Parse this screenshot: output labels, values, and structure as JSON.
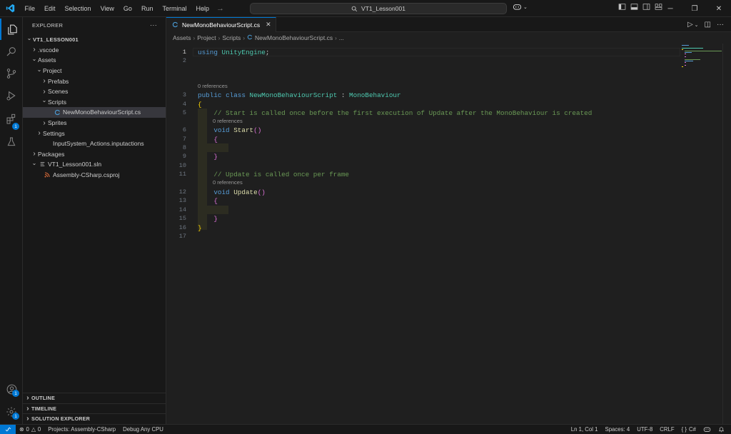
{
  "titlebar": {
    "menu": [
      "File",
      "Edit",
      "Selection",
      "View",
      "Go",
      "Run",
      "Terminal",
      "Help"
    ],
    "search_text": "VT1_Lesson001"
  },
  "activity_bar": {
    "extensions_badge": "1",
    "accounts_badge": "1",
    "settings_badge": "1"
  },
  "sidebar": {
    "title": "EXPLORER",
    "more": "···",
    "tree": [
      {
        "label": "VT1_LESSON001",
        "depth": 0,
        "chevron": "down",
        "icon": "",
        "root": true
      },
      {
        "label": ".vscode",
        "depth": 1,
        "chevron": "right",
        "icon": ""
      },
      {
        "label": "Assets",
        "depth": 1,
        "chevron": "down",
        "icon": ""
      },
      {
        "label": "Project",
        "depth": 2,
        "chevron": "down",
        "icon": ""
      },
      {
        "label": "Prefabs",
        "depth": 3,
        "chevron": "right",
        "icon": ""
      },
      {
        "label": "Scenes",
        "depth": 3,
        "chevron": "right",
        "icon": ""
      },
      {
        "label": "Scripts",
        "depth": 3,
        "chevron": "down",
        "icon": ""
      },
      {
        "label": "NewMonoBehaviourScript.cs",
        "depth": 4,
        "chevron": "",
        "icon": "csharp",
        "selected": true
      },
      {
        "label": "Sprites",
        "depth": 3,
        "chevron": "right",
        "icon": ""
      },
      {
        "label": "Settings",
        "depth": 2,
        "chevron": "right",
        "icon": ""
      },
      {
        "label": "InputSystem_Actions.inputactions",
        "depth": 2,
        "chevron": "",
        "icon": "file"
      },
      {
        "label": "Packages",
        "depth": 1,
        "chevron": "right",
        "icon": ""
      },
      {
        "label": "VT1_Lesson001.sln",
        "depth": 1,
        "chevron": "down",
        "icon": "sln"
      },
      {
        "label": "Assembly-CSharp.csproj",
        "depth": 2,
        "chevron": "",
        "icon": "rss"
      }
    ],
    "sections": [
      "OUTLINE",
      "TIMELINE",
      "SOLUTION EXPLORER"
    ]
  },
  "editor": {
    "tab_label": "NewMonoBehaviourScript.cs",
    "breadcrumb": [
      "Assets",
      "Project",
      "Scripts",
      "NewMonoBehaviourScript.cs",
      "..."
    ],
    "codelens": "0 references",
    "lines": [
      [
        {
          "t": "using ",
          "c": "kw"
        },
        {
          "t": "UnityEngine",
          "c": "ns"
        },
        {
          "t": ";",
          "c": "pl"
        }
      ],
      [],
      [
        {
          "t": "public ",
          "c": "kw"
        },
        {
          "t": "class ",
          "c": "kw"
        },
        {
          "t": "NewMonoBehaviourScript",
          "c": "cls"
        },
        {
          "t": " : ",
          "c": "pl"
        },
        {
          "t": "MonoBehaviour",
          "c": "cls"
        }
      ],
      [
        {
          "t": "{",
          "c": "br1"
        }
      ],
      [
        {
          "t": "    // Start is called once before the first execution of Update after the MonoBehaviour is created",
          "c": "cmt"
        }
      ],
      [
        {
          "t": "    void ",
          "c": "kw"
        },
        {
          "t": "Start",
          "c": "fn"
        },
        {
          "t": "()",
          "c": "br2"
        }
      ],
      [
        {
          "t": "    {",
          "c": "br2"
        }
      ],
      [],
      [
        {
          "t": "    }",
          "c": "br2"
        }
      ],
      [],
      [
        {
          "t": "    // Update is called once per frame",
          "c": "cmt"
        }
      ],
      [
        {
          "t": "    void ",
          "c": "kw"
        },
        {
          "t": "Update",
          "c": "fn"
        },
        {
          "t": "()",
          "c": "br2"
        }
      ],
      [
        {
          "t": "    {",
          "c": "br2"
        }
      ],
      [],
      [
        {
          "t": "    }",
          "c": "br2"
        }
      ],
      [
        {
          "t": "}",
          "c": "br1"
        }
      ],
      []
    ]
  },
  "statusbar": {
    "errors": "0",
    "warnings": "0",
    "project": "Projects: Assembly-CSharp",
    "debug": "Debug Any CPU",
    "position": "Ln 1, Col 1",
    "spaces": "Spaces: 4",
    "encoding": "UTF-8",
    "eol": "CRLF",
    "language": "C#"
  },
  "colors": {
    "accent": "#0078d4",
    "keyword": "#569cd6",
    "type": "#4ec9b0",
    "function": "#dcdcaa",
    "comment": "#6a9955",
    "csharp_icon": "#4a9cd6",
    "rss_icon": "#e8703a"
  }
}
